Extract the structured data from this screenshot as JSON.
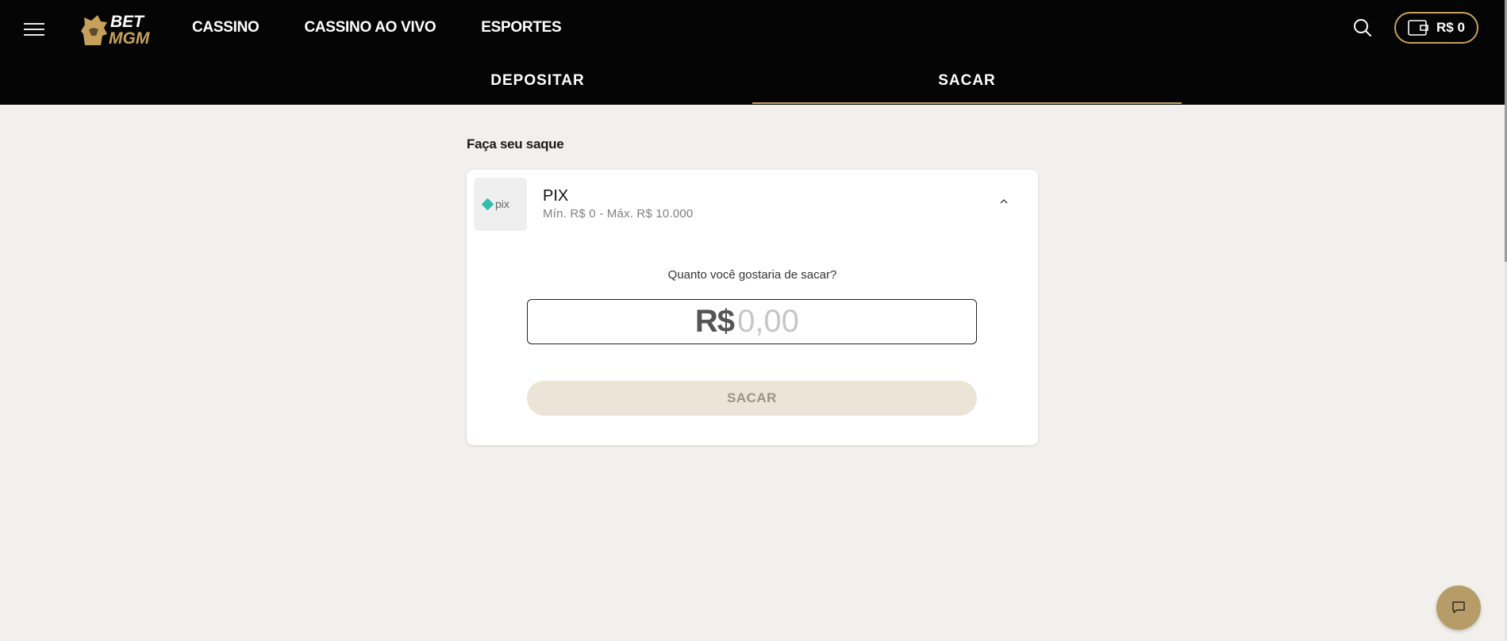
{
  "header": {
    "brand_top": "BET",
    "brand_bottom": "MGM",
    "nav": [
      {
        "label": "CASSINO"
      },
      {
        "label": "CASSINO AO VIVO"
      },
      {
        "label": "ESPORTES"
      }
    ],
    "wallet_balance": "R$ 0"
  },
  "tabs": [
    {
      "label": "DEPOSITAR",
      "active": false
    },
    {
      "label": "SACAR",
      "active": true
    }
  ],
  "withdraw": {
    "title": "Faça seu saque",
    "method": {
      "name": "PIX",
      "logo_text": "pix",
      "limits": "Mín. R$ 0 - Máx. R$ 10.000"
    },
    "question": "Quanto você gostaria de sacar?",
    "currency_symbol": "R$",
    "amount_placeholder": "0,00",
    "submit_label": "SACAR"
  },
  "colors": {
    "header_bg": "#050505",
    "accent_gold": "#c6a15b",
    "page_bg": "#f1f0ec",
    "pix_teal": "#32bcad",
    "chat_button": "#b89c68"
  },
  "icons": {
    "menu": "hamburger-menu-icon",
    "search": "search-icon",
    "wallet": "wallet-icon",
    "chevron": "chevron-up-icon",
    "chat": "chat-icon"
  }
}
